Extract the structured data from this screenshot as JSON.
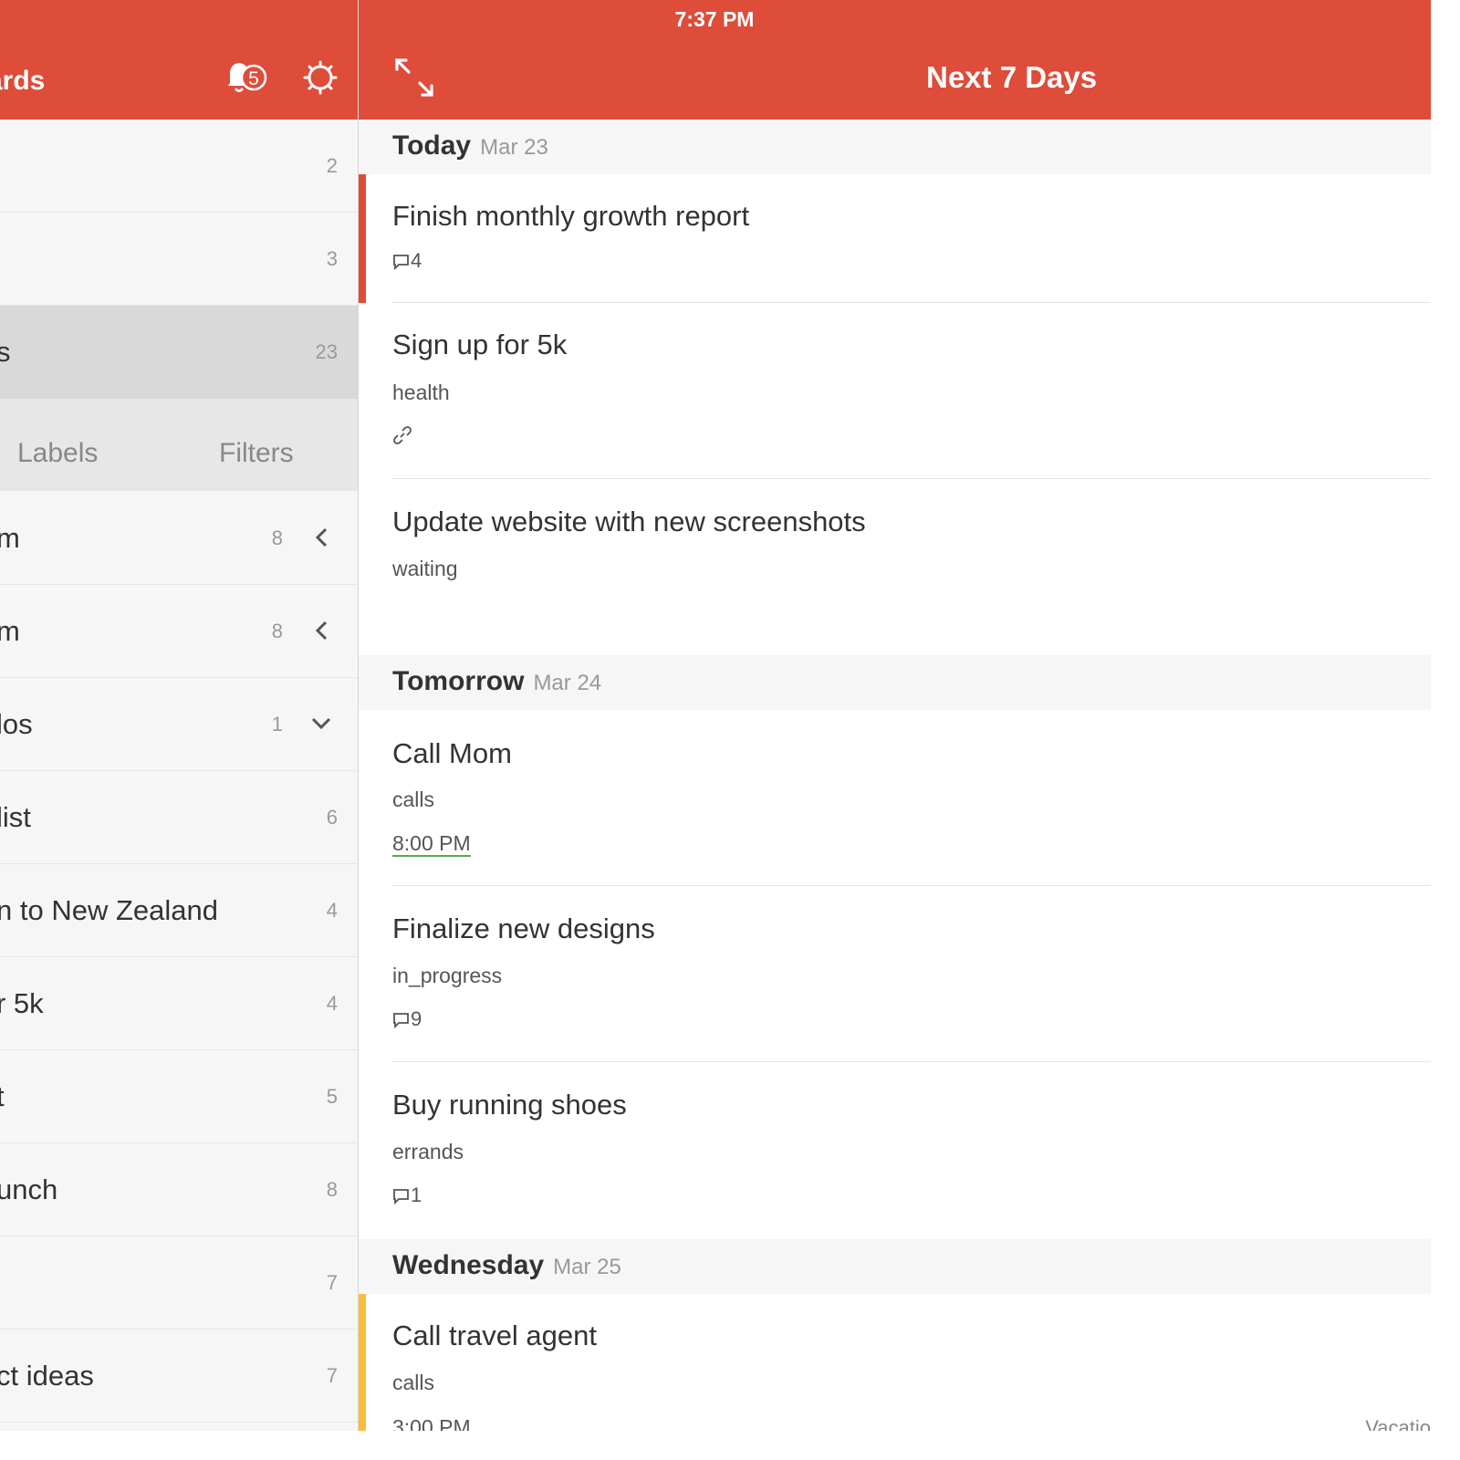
{
  "left_panel": {
    "header_title": "ards",
    "notification_badge": "5",
    "rows_top": [
      {
        "name": "",
        "count": "2"
      },
      {
        "name": "",
        "count": "3"
      },
      {
        "name": "s",
        "count": "23"
      }
    ],
    "tabs": {
      "labels": "Labels",
      "filters": "Filters"
    },
    "projects": [
      {
        "name": "m",
        "count": "8"
      },
      {
        "name": "m",
        "count": "8"
      },
      {
        "name": "los",
        "count": "1"
      },
      {
        "name": " list",
        "count": "6"
      },
      {
        "name": "n to New Zealand",
        "count": "4"
      },
      {
        "name": "r 5k",
        "count": "4"
      },
      {
        "name": "t",
        "count": "5"
      },
      {
        "name": "unch",
        "count": "8"
      },
      {
        "name": "",
        "count": "7"
      },
      {
        "name": "ct ideas",
        "count": "7"
      }
    ]
  },
  "status_bar": {
    "time": "7:37 PM"
  },
  "main": {
    "title": "Next 7 Days",
    "sections": [
      {
        "day": "Today",
        "date": "Mar 23"
      },
      {
        "day": "Tomorrow",
        "date": "Mar 24"
      },
      {
        "day": "Wednesday",
        "date": "Mar 25"
      }
    ],
    "tasks": [
      {
        "title": "Finish monthly growth report",
        "comments": "4"
      },
      {
        "title": "Sign up for 5k",
        "label": "health"
      },
      {
        "title": "Update website with new screenshots",
        "label": "waiting"
      },
      {
        "title": "Call Mom",
        "label": "calls",
        "time": "8:00 PM"
      },
      {
        "title": "Finalize new designs",
        "label": "in_progress",
        "comments": "9"
      },
      {
        "title": "Buy running shoes",
        "label": "errands",
        "comments": "1"
      },
      {
        "title": "Call travel agent",
        "label": "calls",
        "time": "3:00 PM",
        "project": "Vacatio"
      }
    ]
  },
  "colors": {
    "brand": "#de4c3a",
    "priority_red": "#de4c3a",
    "priority_yellow": "#fbbc3b",
    "time_underline": "#4caf50"
  }
}
